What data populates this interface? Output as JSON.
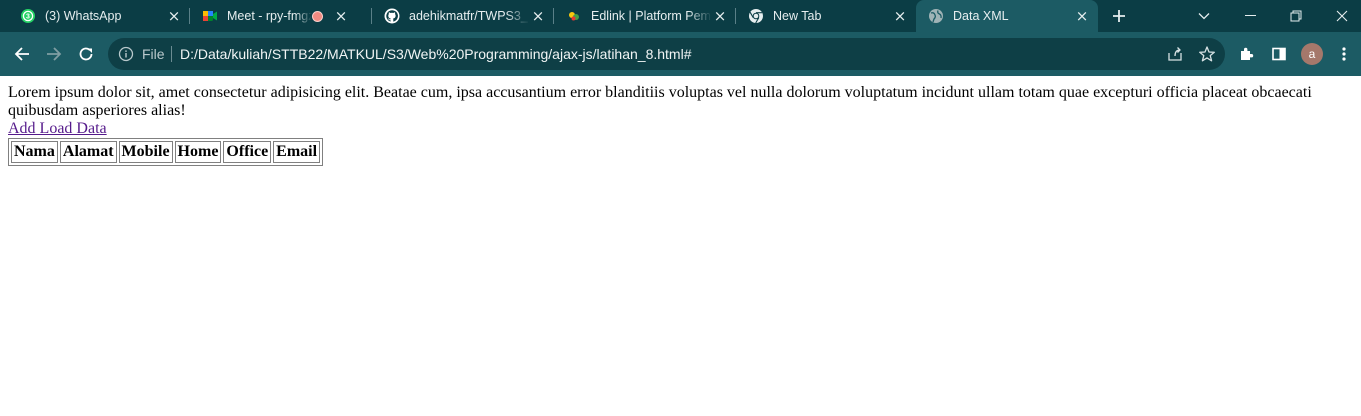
{
  "browser": {
    "tabs": [
      {
        "title": "(3) WhatsApp",
        "icon": "whatsapp-icon",
        "active": false
      },
      {
        "title": "Meet - rpy-fmgz-",
        "icon": "google-meet-icon",
        "active": false,
        "recording": true
      },
      {
        "title": "adehikmatfr/TWPS3_",
        "icon": "github-icon",
        "active": false
      },
      {
        "title": "Edlink | Platform Pem",
        "icon": "edlink-icon",
        "active": false
      },
      {
        "title": "New Tab",
        "icon": "chrome-icon",
        "active": false
      },
      {
        "title": "Data XML",
        "icon": "globe-icon",
        "active": true
      }
    ],
    "address": {
      "scheme_label": "File",
      "url": "D:/Data/kuliah/STTB22/MATKUL/S3/Web%20Programming/ajax-js/latihan_8.html#"
    },
    "profile_initial": "a"
  },
  "page": {
    "paragraph": "Lorem ipsum dolor sit, amet consectetur adipisicing elit. Beatae cum, ipsa accusantium error blanditiis voluptas vel nulla dolorum voluptatum incidunt ullam totam quae excepturi officia placeat obcaecati quibusdam asperiores alias!",
    "link_label": "Add Load Data",
    "table_headers": [
      "Nama",
      "Alamat",
      "Mobile",
      "Home",
      "Office",
      "Email"
    ]
  },
  "colors": {
    "tabstrip_bg": "#0b3d45",
    "toolbar_bg": "#1c5b64",
    "omnibox_bg": "#0e3f46",
    "visited_link": "#551a8b"
  }
}
